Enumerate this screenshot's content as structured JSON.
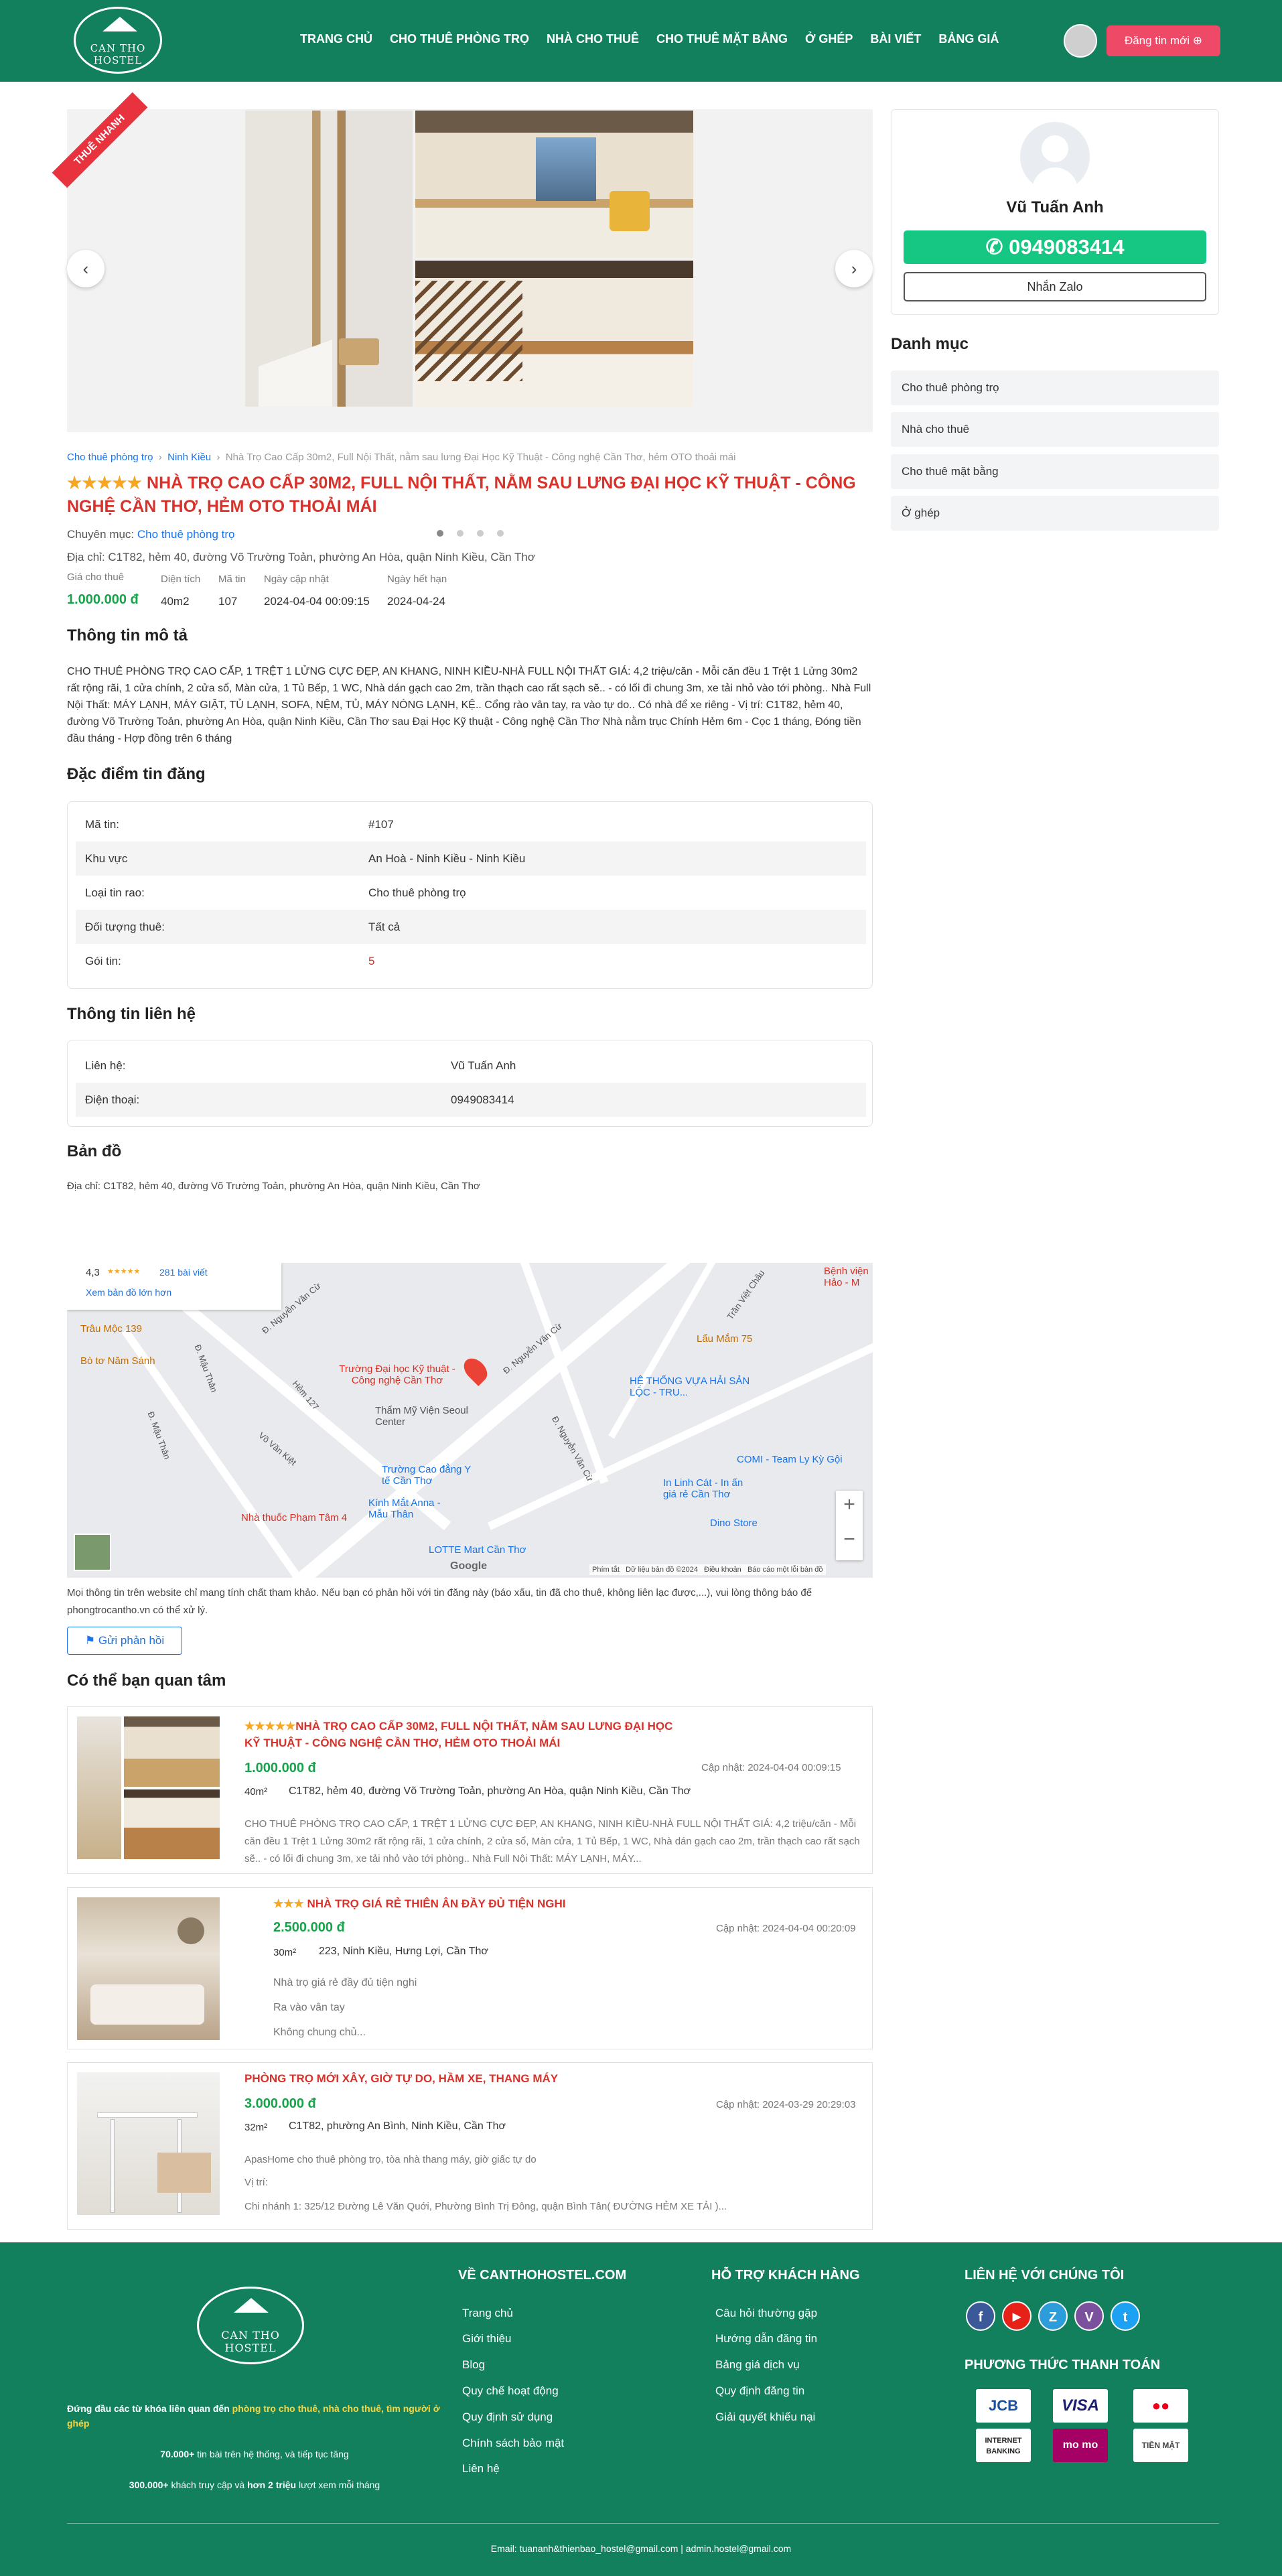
{
  "header": {
    "logo_text": "CAN THO HOSTEL",
    "nav": [
      "TRANG CHỦ",
      "CHO THUÊ PHÒNG TRỌ",
      "NHÀ CHO THUÊ",
      "CHO THUÊ MẶT BẰNG",
      "Ở GHÉP",
      "BÀI VIẾT",
      "BẢNG GIÁ"
    ],
    "post_button": "Đăng tin mới ⊕"
  },
  "gallery": {
    "ribbon": "THUÊ NHANH",
    "prev": "‹",
    "next": "›"
  },
  "owner_card": {
    "name": "Vũ Tuấn Anh",
    "phone": "0949083414",
    "zalo": "Nhắn Zalo"
  },
  "categories": {
    "title": "Danh mục",
    "items": [
      "Cho thuê phòng trọ",
      "Nhà cho thuê",
      "Cho thuê mặt bằng",
      "Ở ghép"
    ]
  },
  "breadcrumb": [
    "Cho thuê phòng trọ",
    "Ninh Kiều",
    "Nhà Trọ Cao Cấp 30m2, Full Nội Thất, nằm sau lưng Đại Học Kỹ Thuật - Công nghệ Cần Thơ, hẻm OTO thoải mái"
  ],
  "listing": {
    "stars": "★★★★★",
    "title": "NHÀ TRỌ CAO CẤP 30M2, FULL NỘI THẤT, NẰM SAU LƯNG ĐẠI HỌC KỸ THUẬT - CÔNG NGHỆ CẦN THƠ, HẺM OTO THOẢI MÁI",
    "category_label": "Chuyên mục:",
    "category": "Cho thuê phòng trọ",
    "address": "Địa chỉ: C1T82, hẻm 40, đường Võ Trường Toản, phường An Hòa, quận Ninh Kiều, Cần Thơ",
    "stats": [
      {
        "label": "Giá cho thuê",
        "value": "1.000.000 đ"
      },
      {
        "label": "Diện tích",
        "value": "40m2"
      },
      {
        "label": "Mã tin",
        "value": "107"
      },
      {
        "label": "Ngày cập nhật",
        "value": "2024-04-04 00:09:15"
      },
      {
        "label": "Ngày hết hạn",
        "value": "2024-04-24"
      }
    ]
  },
  "description": {
    "title": "Thông tin mô tả",
    "text": "CHO THUÊ PHÒNG TRỌ CAO CẤP, 1 TRỆT 1 LỬNG CỰC ĐẸP, AN KHANG, NINH KIỀU-NHÀ FULL NỘI THẤT GIÁ: 4,2 triệu/căn - Mỗi căn đều 1 Trệt 1 Lửng 30m2 rất rộng rãi, 1 cửa chính, 2 cửa sổ, Màn cửa, 1 Tủ Bếp, 1 WC, Nhà dán gạch cao 2m, trần thạch cao rất sạch sẽ.. - có lối đi chung 3m, xe tải nhỏ vào tới phòng.. Nhà Full Nội Thất: MÁY LẠNH, MÁY GIẶT, TỦ LẠNH, SOFA, NỆM, TỦ, MÁY NÓNG LẠNH, KỆ.. Cổng rào vân tay, ra vào tự do.. Có nhà để xe riêng - Vị trí: C1T82, hẻm 40, đường Võ Trường Toản, phường An Hòa, quận Ninh Kiều, Cần Thơ sau Đại Học Kỹ thuật - Công nghệ Cần Thơ Nhà nằm trục Chính Hẻm 6m - Cọc 1 tháng, Đóng tiền đầu tháng - Hợp đồng trên 6 tháng"
  },
  "features": {
    "title": "Đặc điểm tin đăng",
    "rows": [
      {
        "k": "Mã tin:",
        "v": "#107"
      },
      {
        "k": "Khu vực",
        "v": "An Hoà - Ninh Kiều - Ninh Kiều"
      },
      {
        "k": "Loại tin rao:",
        "v": "Cho thuê phòng trọ"
      },
      {
        "k": "Đối tượng thuê:",
        "v": "Tất cả"
      },
      {
        "k": "Gói tin:",
        "v": "5"
      }
    ]
  },
  "contact": {
    "title": "Thông tin liên hệ",
    "rows": [
      {
        "k": "Liên hệ:",
        "v": "Vũ Tuấn Anh"
      },
      {
        "k": "Điện thoại:",
        "v": "0949083414"
      }
    ]
  },
  "map": {
    "title": "Bản đồ",
    "address": "Địa chỉ: C1T82, hẻm 40, đường Võ Trường Toản, phường An Hòa, quận Ninh Kiều, Cần Thơ",
    "rating": "4,3",
    "rating_stars": "★★★★★",
    "reviews": "281 bài viết",
    "larger": "Xem bản đồ lớn hơn",
    "pin_label": "Trường Đại học Kỹ thuật - Công nghệ Cần Thơ",
    "places": [
      "Trâu Mộc 139",
      "Bò tơ Năm Sánh",
      "Thẩm Mỹ Viện Seoul Center",
      "Lẩu Mắm 75",
      "HỆ THỐNG VỰA HẢI SẢN LỘC - TRU...",
      "Trường Cao đẳng Y tế Cần Thơ",
      "Kính Mắt Anna - Mẫu Thân",
      "Nhà thuốc Phạm Tâm 4",
      "LOTTE Mart Cần Thơ",
      "In Linh Cát - In ấn giá rẻ Cần Thơ",
      "COMI - Team Ly Kỳ Gội",
      "Dino Store",
      "Bệnh viện Hảo - M"
    ],
    "streets": [
      "Đ. Nguyễn Văn Cừ",
      "Đ. Nguyễn Văn Cừ",
      "Võ Văn Kiệt",
      "Đ. Mậu Thân",
      "Đ. Mậu Thân",
      "Hẻm 127",
      "Đ. Nguyễn Văn Cừ",
      "Trần Việt Châu"
    ],
    "zoom_in": "+",
    "zoom_out": "−",
    "attribution": [
      "Phím tắt",
      "Dữ liệu bản đồ ©2024",
      "Điều khoản",
      "Báo cáo một lỗi bản đồ"
    ],
    "google": "Google"
  },
  "disclaimer": "Mọi thông tin trên website chỉ mang tính chất tham khảo. Nếu bạn có phản hồi với tin đăng này (báo xấu, tin đã cho thuê, không liên lạc được,...), vui lòng thông báo để phongtrocantho.vn có thể xử lý.",
  "feedback_button": "Gửi phản hồi",
  "related": {
    "title": "Có thể bạn quan tâm",
    "items": [
      {
        "stars": "★★★★★",
        "title": "NHÀ TRỌ CAO CẤP 30M2, FULL NỘI THẤT, NẰM SAU LƯNG ĐẠI HỌC KỸ THUẬT - CÔNG NGHỆ CẦN THƠ, HẺM OTO THOẢI MÁI",
        "price": "1.000.000 đ",
        "updated": "Cập nhật: 2024-04-04 00:09:15",
        "area": "40m²",
        "address": "C1T82, hẻm 40, đường Võ Trường Toản, phường An Hòa, quận Ninh Kiều, Cần Thơ",
        "desc": "CHO THUÊ PHÒNG TRỌ CAO CẤP, 1 TRỆT 1 LỬNG CỰC ĐẸP, AN KHANG, NINH KIỀU-NHÀ FULL NỘI THẤT GIÁ: 4,2 triệu/căn - Mỗi căn đều 1 Trệt 1 Lửng 30m2 rất rộng rãi, 1 cửa chính, 2 cửa sổ, Màn cửa, 1 Tủ Bếp, 1 WC, Nhà dán gạch cao 2m, trần thạch cao rất sạch sẽ.. - có lối đi chung 3m, xe tải nhỏ vào tới phòng.. Nhà Full Nội Thất: MÁY LẠNH, MÁY..."
      },
      {
        "stars": "★★★",
        "title": "NHÀ TRỌ GIÁ RẺ THIÊN ÂN ĐẦY ĐỦ TIỆN NGHI",
        "price": "2.500.000 đ",
        "updated": "Cập nhật: 2024-04-04 00:20:09",
        "area": "30m²",
        "address": "223, Ninh Kiều, Hưng Lợi, Cần Thơ",
        "desc_lines": [
          "Nhà trọ giá rẻ đầy đủ tiện nghi",
          "Ra vào vân tay",
          "Không chung chủ..."
        ]
      },
      {
        "stars": "",
        "title": "PHÒNG TRỌ MỚI XÂY, GIỜ TỰ DO, HẦM XE, THANG MÁY",
        "price": "3.000.000 đ",
        "updated": "Cập nhật: 2024-03-29 20:29:03",
        "area": "32m²",
        "address": "C1T82, phường An Bình, Ninh Kiều, Cần Thơ",
        "desc_lines": [
          "ApasHome cho thuê phòng trọ, tòa nhà thang máy, giờ giấc tự do",
          "Vị trí:",
          "Chi nhánh 1: 325/12 Đường Lê Văn Quới, Phường Bình Trị Đông, quận Bình Tân( ĐƯỜNG HẺM XE TẢI )..."
        ]
      }
    ]
  },
  "footer": {
    "logo_text": "CAN THO HOSTEL",
    "tagline_pre": "Đứng đầu các từ khóa liên quan đến ",
    "tagline_hl": "phòng trọ cho thuê, nhà cho thuê, tìm người ở ghép",
    "stat1_b": "70.000+",
    "stat1": " tin bài trên hệ thống, và tiếp tục tăng",
    "stat2_b": "300.000+",
    "stat2_mid": " khách truy cập và ",
    "stat2_b2": "hơn 2 triệu",
    "stat2": " lượt xem mỗi tháng",
    "col1_title": "VỀ CANTHOHOSTEL.COM",
    "col1": [
      "Trang chủ",
      "Giới thiệu",
      "Blog",
      "Quy chế hoạt động",
      "Quy định sử dụng",
      "Chính sách bảo mật",
      "Liên hệ"
    ],
    "col2_title": "HỖ TRỢ KHÁCH HÀNG",
    "col2": [
      "Câu hỏi thường gặp",
      "Hướng dẫn đăng tin",
      "Bảng giá dịch vụ",
      "Quy định đăng tin",
      "Giải quyết khiếu nại"
    ],
    "col3_title": "LIÊN HỆ VỚI CHÚNG TÔI",
    "social": [
      "f",
      "▶",
      "Z",
      "V",
      "t"
    ],
    "pay_title": "PHƯƠNG THỨC THANH TOÁN",
    "payments": [
      "JCB",
      "VISA",
      "●●",
      "INTERNET BANKING",
      "mo mo",
      "TIỀN MẶT"
    ],
    "email": "Email: tuananh&thienbao_hostel@gmail.com | admin.hostel@gmail.com"
  }
}
